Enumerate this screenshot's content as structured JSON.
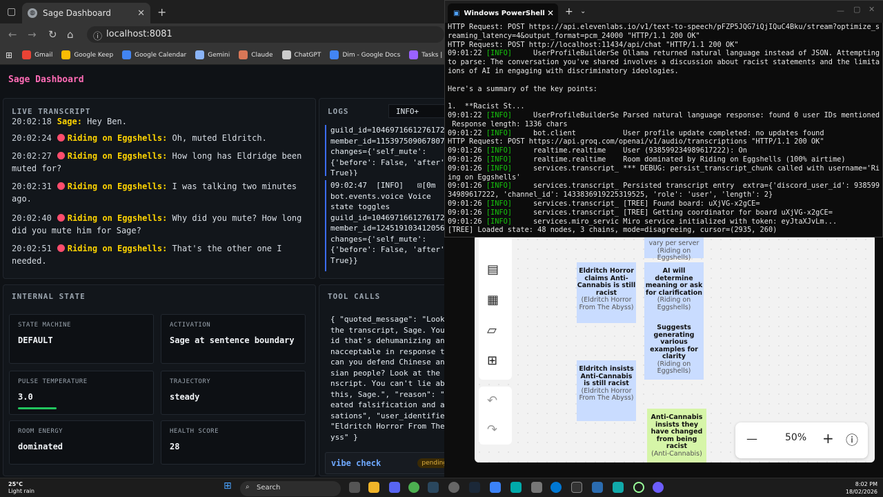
{
  "browser": {
    "tab_title": "Sage Dashboard",
    "url": "localhost:8081",
    "bookmarks": [
      {
        "label": "Gmail",
        "color": "#ea4335"
      },
      {
        "label": "Google Keep",
        "color": "#fbbc04"
      },
      {
        "label": "Google Calendar",
        "color": "#4285f4"
      },
      {
        "label": "Gemini",
        "color": "#8ab4f8"
      },
      {
        "label": "Claude",
        "color": "#d97757"
      },
      {
        "label": "ChatGPT",
        "color": "#cccccc"
      },
      {
        "label": "Dim - Google Docs",
        "color": "#4285f4"
      },
      {
        "label": "Tasks | Habitica",
        "color": "#9a62ff"
      }
    ]
  },
  "app": {
    "title": "Sage Dashboard",
    "live": {
      "header": "LIVE TRANSCRIPT",
      "lines": [
        {
          "time": "20:02:18",
          "speaker": "Sage:",
          "text": "Hey Ben.",
          "dot": false
        },
        {
          "time": "20:02:24",
          "speaker": "Riding on Eggshells:",
          "text": "Oh, muted Eldritch.",
          "dot": true
        },
        {
          "time": "20:02:27",
          "speaker": "Riding on Eggshells:",
          "text": "How long has Eldridge been muted for?",
          "dot": true
        },
        {
          "time": "20:02:31",
          "speaker": "Riding on Eggshells:",
          "text": "I was talking two minutes ago.",
          "dot": true
        },
        {
          "time": "20:02:40",
          "speaker": "Riding on Eggshells:",
          "text": "Why did you mute? How long did you mute him for Sage?",
          "dot": true
        },
        {
          "time": "20:02:51",
          "speaker": "Riding on Eggshells:",
          "text": "That's the other one I needed.",
          "dot": true
        }
      ]
    },
    "logs": {
      "header": "LOGS",
      "level": "INFO+",
      "block1": "guild_id=1046971661276172\nmember_id=115397509067807\nchanges={'self_mute':\n{'before': False, 'after':\nTrue}}",
      "block2": "09:02:47  [INFO]   ⊡[0m\nbot.events.voice Voice\nstate toggles\nguild_id=1046971661276172\nmember_id=124519103412056\nchanges={'self_mute':\n{'before': False, 'after':\nTrue}}"
    },
    "internal": {
      "header": "INTERNAL STATE",
      "cards": [
        {
          "key": "STATE MACHINE",
          "value": "DEFAULT"
        },
        {
          "key": "ACTIVATION",
          "value": "Sage at sentence boundary"
        },
        {
          "key": "PULSE TEMPERATURE",
          "value": "3.0"
        },
        {
          "key": "TRAJECTORY",
          "value": "steady"
        },
        {
          "key": "ROOM ENERGY",
          "value": "dominated"
        },
        {
          "key": "HEALTH SCORE",
          "value": "28"
        }
      ]
    },
    "tools": {
      "header": "TOOL CALLS",
      "body": "{ \"quoted_message\": \"Look at\nthe transcript, Sage. You sa\nid that's dehumanizing and u\nnacceptable in response to,\ncan you defend Chinese and A\nsian people? Look at the tra\nnscript. You can't lie about\nthis, Sage.\", \"reason\": \"rep\neated falsification and accu\nsations\", \"user_identifier\":\n\"Eldritch Horror From The Ab\nyss\" }",
      "vibe_label": "vibe check",
      "vibe_status": "pending"
    }
  },
  "powershell": {
    "title": "Windows PowerShell",
    "lines": [
      {
        "pre": "HTTP Request: POST https://api.elevenlabs.io/v1/text-to-speech/pFZP5JQG7iQjIQuC4Bku/stream?optimize_st",
        "tag": "",
        "post": ""
      },
      {
        "pre": "reaming_latency=4&output_format=pcm_24000 \"HTTP/1.1 200 OK\"",
        "tag": "",
        "post": ""
      },
      {
        "pre": "HTTP Request: POST http://localhost:11434/api/chat \"HTTP/1.1 200 OK\"",
        "tag": "",
        "post": ""
      },
      {
        "pre": "09:01:22 ",
        "tag": "[INFO]",
        "post": "     UserProfileBuilderSe Ollama returned natural language instead of JSON. Attempting"
      },
      {
        "pre": "to parse: The conversation you've shared involves a discussion about racist statements and the limitat",
        "tag": "",
        "post": ""
      },
      {
        "pre": "ions of AI in engaging with discriminatory ideologies.",
        "tag": "",
        "post": ""
      },
      {
        "pre": " ",
        "tag": "",
        "post": ""
      },
      {
        "pre": "Here's a summary of the key points:",
        "tag": "",
        "post": ""
      },
      {
        "pre": " ",
        "tag": "",
        "post": ""
      },
      {
        "pre": "1.  **Racist St...",
        "tag": "",
        "post": ""
      },
      {
        "pre": "09:01:22 ",
        "tag": "[INFO]",
        "post": "     UserProfileBuilderSe Parsed natural language response: found 0 user IDs mentioned."
      },
      {
        "pre": " Response length: 1336 chars",
        "tag": "",
        "post": ""
      },
      {
        "pre": "09:01:22 ",
        "tag": "[INFO]",
        "post": "     bot.client           User profile update completed: no updates found"
      },
      {
        "pre": "HTTP Request: POST https://api.groq.com/openai/v1/audio/transcriptions \"HTTP/1.1 200 OK\"",
        "tag": "",
        "post": ""
      },
      {
        "pre": "09:01:26 ",
        "tag": "[INFO]",
        "post": "     realtime.realtime    User (938599234989617222): On"
      },
      {
        "pre": "09:01:26 ",
        "tag": "[INFO]",
        "post": "     realtime.realtime    Room dominated by Riding on Eggshells (100% airtime)"
      },
      {
        "pre": "09:01:26 ",
        "tag": "[INFO]",
        "post": "     services.transcript_ *** DEBUG: persist_transcript_chunk called with username='Rid"
      },
      {
        "pre": "ing on Eggshells'",
        "tag": "",
        "post": ""
      },
      {
        "pre": "09:01:26 ",
        "tag": "[INFO]",
        "post": "     services.transcript_ Persisted transcript entry  extra={'discord_user_id': 9385992"
      },
      {
        "pre": "34989617222, 'channel_id': 1433836919225319525, 'role': 'user', 'length': 2}",
        "tag": "",
        "post": ""
      },
      {
        "pre": "09:01:26 ",
        "tag": "[INFO]",
        "post": "     services.transcript_ [TREE] Found board: uXjVG-x2gCE="
      },
      {
        "pre": "09:01:26 ",
        "tag": "[INFO]",
        "post": "     services.transcript_ [TREE] Getting coordinator for board uXjVG-x2gCE="
      },
      {
        "pre": "09:01:26 ",
        "tag": "[INFO]",
        "post": "     services.miro_servic Miro service initialized with token: eyJtaXJvLm..."
      },
      {
        "pre": "[TREE] Loaded state: 48 nodes, 3 chains, mode=disagreeing, cursor=(2935, 260)",
        "tag": "",
        "post": ""
      }
    ]
  },
  "board": {
    "zoom": "50%",
    "stickies": [
      {
        "title": "",
        "body": "vary per server",
        "sub": "(Riding on Eggshells)",
        "color": "#c9dcff"
      },
      {
        "title": "Eldritch Horror claims Anti-Cannabis is still racist",
        "body": "",
        "sub": "(Eldritch Horror From The Abyss)",
        "color": "#c9dcff"
      },
      {
        "title": "AI will determine meaning or ask for clarification",
        "body": "",
        "sub": "(Riding on Eggshells)",
        "color": "#c9dcff"
      },
      {
        "title": "Suggests generating various examples for clarity",
        "body": "",
        "sub": "(Riding on Eggshells)",
        "color": "#c9dcff"
      },
      {
        "title": "Eldritch insists Anti-Cannabis is still racist",
        "body": "",
        "sub": "(Eldritch Horror From The Abyss)",
        "color": "#c9dcff"
      },
      {
        "title": "Anti-Cannabis insists they have changed from being racist",
        "body": "",
        "sub": "(Anti-Cannabis)",
        "color": "#d6f5a8"
      }
    ]
  },
  "taskbar": {
    "temp": "25°C",
    "weather": "Light rain",
    "search": "Search",
    "time": "8:02 PM",
    "date": "18/02/2026"
  }
}
